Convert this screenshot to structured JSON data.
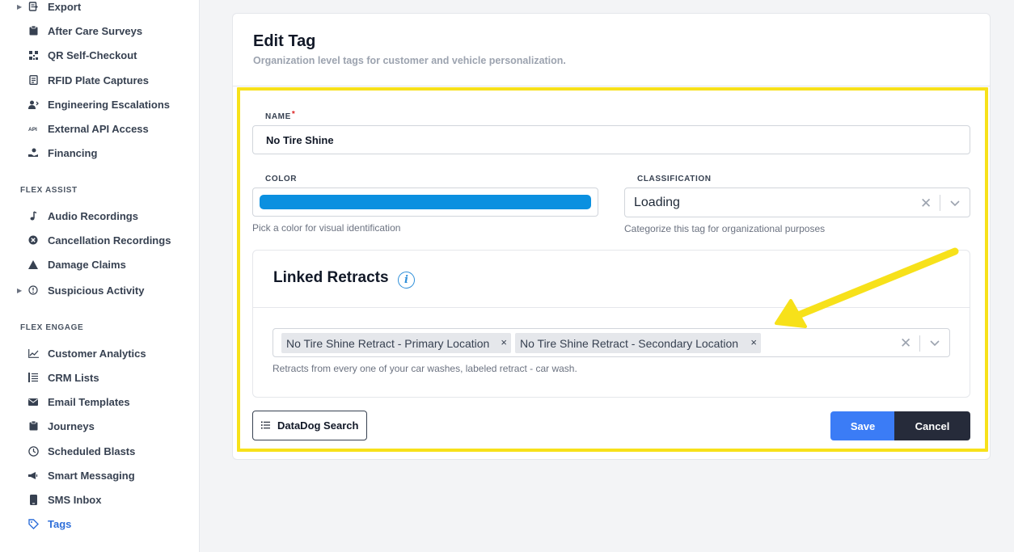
{
  "sidebar": {
    "items_top": [
      {
        "label": "Export",
        "icon": "export-icon",
        "caret": true
      },
      {
        "label": "After Care Surveys",
        "icon": "clipboard-icon"
      },
      {
        "label": "QR Self-Checkout",
        "icon": "qr-code-icon"
      },
      {
        "label": "RFID Plate Captures",
        "icon": "document-icon"
      },
      {
        "label": "Engineering Escalations",
        "icon": "user-escalation-icon"
      },
      {
        "label": "External API Access",
        "icon": "api-icon"
      },
      {
        "label": "Financing",
        "icon": "hand-coin-icon"
      }
    ],
    "flex_assist": {
      "heading": "FLEX ASSIST",
      "items": [
        {
          "label": "Audio Recordings",
          "icon": "music-note-icon"
        },
        {
          "label": "Cancellation Recordings",
          "icon": "cancel-circle-icon"
        },
        {
          "label": "Damage Claims",
          "icon": "warning-triangle-icon"
        },
        {
          "label": "Suspicious Activity",
          "icon": "alert-circle-icon",
          "caret": true
        }
      ]
    },
    "flex_engage": {
      "heading": "FLEX ENGAGE",
      "items": [
        {
          "label": "Customer Analytics",
          "icon": "line-chart-icon"
        },
        {
          "label": "CRM Lists",
          "icon": "list-icon"
        },
        {
          "label": "Email Templates",
          "icon": "envelope-icon"
        },
        {
          "label": "Journeys",
          "icon": "clipboard-icon"
        },
        {
          "label": "Scheduled Blasts",
          "icon": "clock-icon"
        },
        {
          "label": "Smart Messaging",
          "icon": "megaphone-icon"
        },
        {
          "label": "SMS Inbox",
          "icon": "phone-icon"
        },
        {
          "label": "Tags",
          "icon": "tag-icon",
          "active": true
        }
      ]
    }
  },
  "form": {
    "title": "Edit Tag",
    "subtitle": "Organization level tags for customer and vehicle personalization.",
    "name_label": "NAME",
    "name_required_mark": "*",
    "name_value": "No Tire Shine",
    "color_label": "COLOR",
    "color_value": "#0b90e0",
    "color_help": "Pick a color for visual identification",
    "classification_label": "CLASSIFICATION",
    "classification_value": "Loading",
    "classification_help": "Categorize this tag for organizational purposes",
    "linked": {
      "title": "Linked Retracts",
      "chips": [
        "No Tire Shine Retract - Primary Location",
        "No Tire Shine Retract - Secondary Location"
      ],
      "chip_remove": "×",
      "help": "Retracts from every one of your car washes, labeled retract - car wash."
    },
    "datadog_label": "DataDog Search",
    "save_label": "Save",
    "cancel_label": "Cancel"
  },
  "colors": {
    "accent": "#3b7cf6",
    "highlight": "#f7e11a",
    "active_nav": "#2f6fd9",
    "cancel_bg": "#262b3a"
  }
}
